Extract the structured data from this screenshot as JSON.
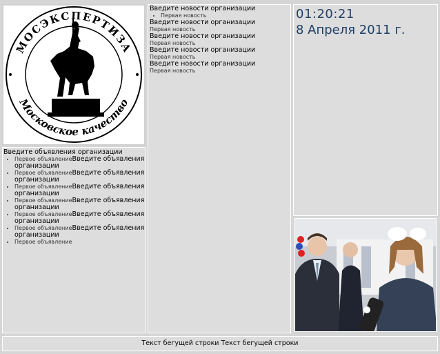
{
  "logo": {
    "circle_text_top": "МОСЭКСПЕРТИЗА",
    "circle_text_bottom": "Московское качество"
  },
  "news": {
    "items": [
      {
        "heading": "Введите новости организации",
        "text": "Первая новость",
        "bullet": true
      },
      {
        "heading": "Введите новости организации",
        "text": "Первая новость",
        "bullet": false
      },
      {
        "heading": "Введите новости организации",
        "text": "Первая новость",
        "bullet": false
      },
      {
        "heading": "Введите новости организации",
        "text": "Первая новость",
        "bullet": false
      },
      {
        "heading": "Введите новости организации",
        "text": "Первая новость",
        "bullet": false
      }
    ]
  },
  "ads": {
    "heading": "Введите объявления организации",
    "items": [
      {
        "small": "Первое объявление",
        "big": "Введите объявления организации"
      },
      {
        "small": "Первое объявление",
        "big": "Введите объявления организации"
      },
      {
        "small": "Первое объявление",
        "big": "Введите объявления организации"
      },
      {
        "small": "Первое объявление",
        "big": "Введите объявления организации"
      },
      {
        "small": "Первое объявление",
        "big": "Введите объявления организации"
      },
      {
        "small": "Первое объявление",
        "big": "Введите объявления организации"
      },
      {
        "small": "Первое объявление",
        "big": ""
      }
    ]
  },
  "clock": {
    "time": "01:20:21",
    "date": "8 Апреля 2011 г."
  },
  "ticker": {
    "text": "Текст бегущей строки Текст бегущей строки"
  },
  "colors": {
    "clock": "#1f3f66",
    "panel": "#dddddd"
  }
}
